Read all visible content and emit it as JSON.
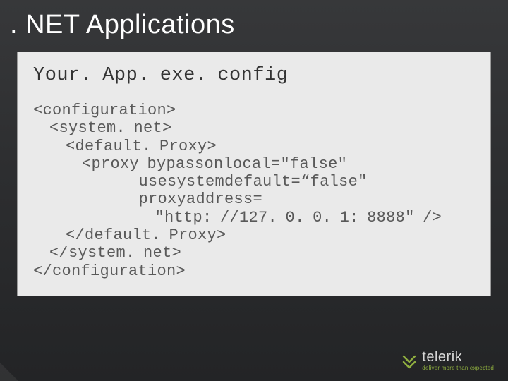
{
  "slide": {
    "title": ". NET Applications"
  },
  "card": {
    "filename": "Your. App. exe. config",
    "code_lines": [
      "<configuration>",
      "  <system. net>",
      "    <default. Proxy>",
      "      <proxy bypassonlocal=\"false\"",
      "             usesystemdefault=“false\"",
      "             proxyaddress=",
      "               \"http: //127. 0. 0. 1: 8888\" />",
      "    </default. Proxy>",
      "  </system. net>",
      "</configuration>"
    ]
  },
  "brand": {
    "name": "telerik",
    "tagline": "deliver more than expected"
  }
}
